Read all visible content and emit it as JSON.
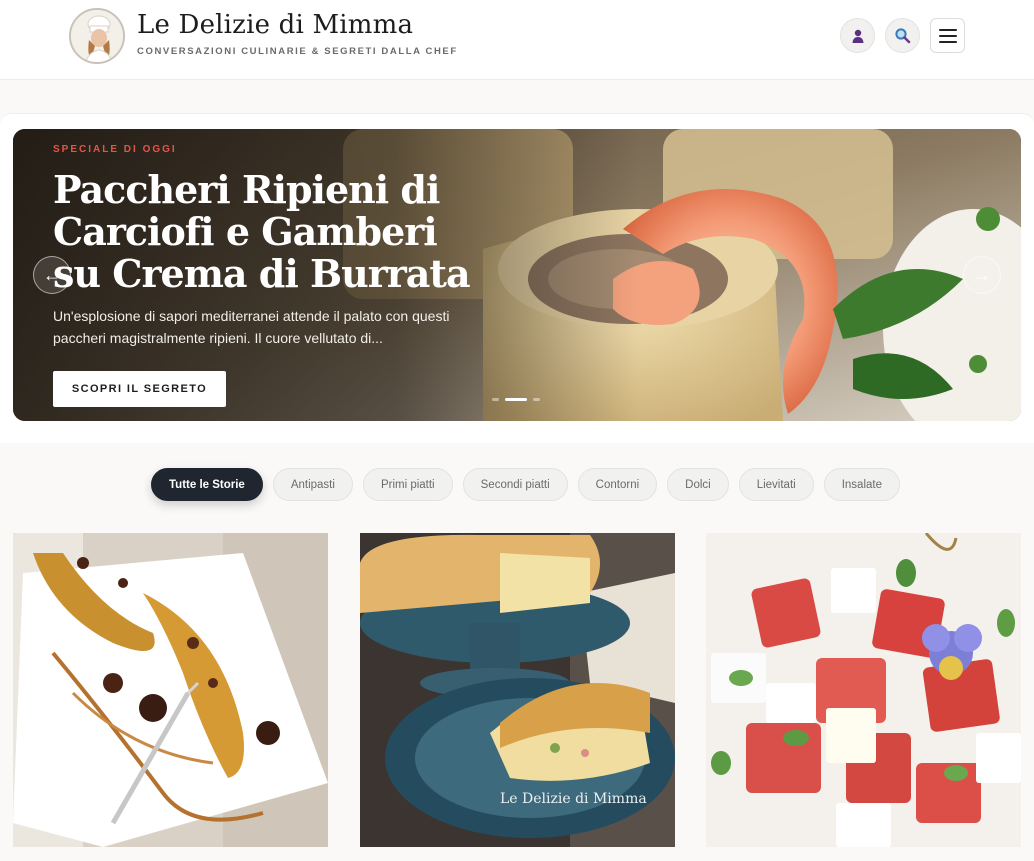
{
  "header": {
    "title": "Le Delizie di Mimma",
    "tagline": "CONVERSAZIONI CULINARIE & SEGRETI DALLA CHEF",
    "icons": {
      "user": "user-icon",
      "search": "search-icon",
      "menu": "hamburger-menu-icon"
    }
  },
  "hero": {
    "kicker": "SPECIALE DI OGGI",
    "title": "Paccheri Ripieni di Carciofi e Gamberi su Crema di Burrata",
    "description": "Un'esplosione di sapori mediterranei attende il palato con questi paccheri magistralmente ripieni. Il cuore vellutato di...",
    "cta": "SCOPRI IL SEGRETO",
    "prev_arrow": "←",
    "next_arrow": "→",
    "slides_count": 3,
    "active_slide": 2
  },
  "categories": {
    "items": [
      "Tutte le Storie",
      "Antipasti",
      "Primi piatti",
      "Secondi piatti",
      "Contorni",
      "Dolci",
      "Lievitati",
      "Insalate"
    ],
    "active": "Tutte le Storie"
  },
  "cards": [
    {
      "image": "caramelized-banana-dessert"
    },
    {
      "image": "lattice-quiche",
      "watermark": "Le Delizie di Mimma"
    },
    {
      "image": "watermelon-feta-salad"
    }
  ],
  "colors": {
    "accent": "#e0574a",
    "dark": "#1f2630",
    "user_icon": "#5b2f86",
    "search_icon": "#3b7bb8"
  }
}
